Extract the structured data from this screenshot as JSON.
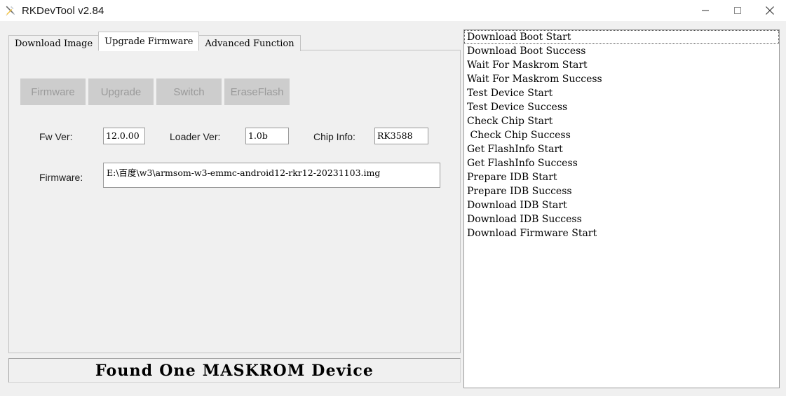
{
  "window": {
    "title": "RKDevTool v2.84",
    "app_icon": "tools-cross-icon",
    "controls": {
      "minimize": "minimize-icon",
      "maximize": "maximize-icon",
      "close": "close-icon"
    }
  },
  "tabs": [
    {
      "label": "Download Image",
      "active": false
    },
    {
      "label": "Upgrade Firmware",
      "active": true
    },
    {
      "label": "Advanced Function",
      "active": false
    }
  ],
  "actions": [
    {
      "label": "Firmware",
      "disabled": true
    },
    {
      "label": "Upgrade",
      "disabled": true
    },
    {
      "label": "Switch",
      "disabled": true
    },
    {
      "label": "EraseFlash",
      "disabled": true
    }
  ],
  "fields": {
    "fw_ver_label": "Fw Ver:",
    "fw_ver_value": "12.0.00",
    "loader_ver_label": "Loader Ver:",
    "loader_ver_value": "1.0b",
    "chip_info_label": "Chip Info:",
    "chip_info_value": "RK3588",
    "firmware_label": "Firmware:",
    "firmware_value": "E:\\百度\\w3\\armsom-w3-emmc-android12-rkr12-20231103.img"
  },
  "status": {
    "text": "Found One MASKROM Device"
  },
  "log": {
    "focused_index": 0,
    "lines": [
      "Download Boot Start",
      "Download Boot Success",
      "Wait For Maskrom Start",
      "Wait For Maskrom Success",
      "Test Device Start",
      "Test Device Success",
      "Check Chip Start",
      " Check Chip Success",
      "Get FlashInfo Start",
      "Get FlashInfo Success",
      "Prepare IDB Start",
      "Prepare IDB Success",
      "Download IDB Start",
      "Download IDB Success",
      "Download Firmware Start"
    ]
  },
  "colors": {
    "window_bg": "#f0f0f0",
    "titlebar_bg": "#ffffff",
    "panel_border": "#c2c2c2",
    "input_border": "#9a9a9a",
    "button_disabled_bg": "#cdcdcd",
    "button_disabled_text": "#9a9a9a",
    "log_bg": "#ffffff",
    "text": "#000000"
  }
}
